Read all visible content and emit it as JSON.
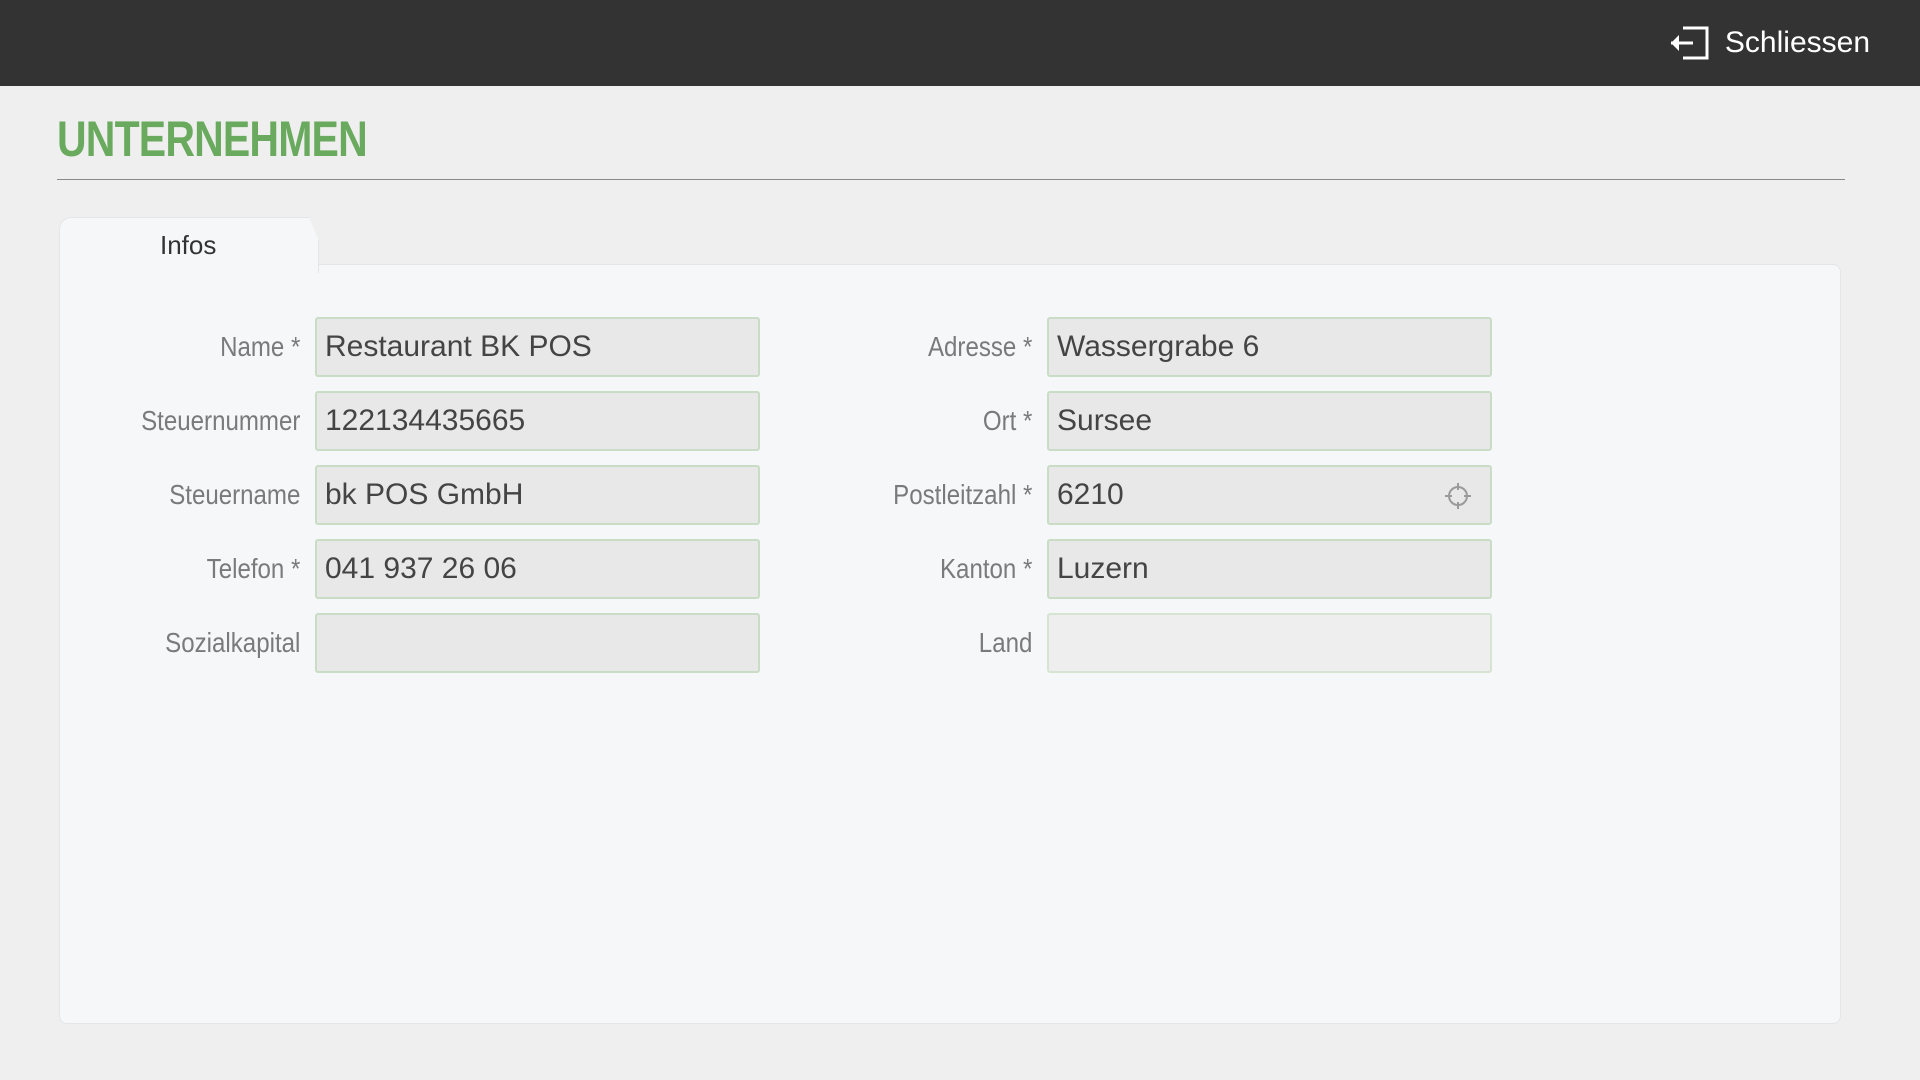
{
  "header": {
    "close_label": "Schliessen",
    "close_icon": "exit-icon"
  },
  "page": {
    "title": "UNTERNEHMEN",
    "title_color": "#6aaa5e"
  },
  "tabs": [
    {
      "label": "Infos",
      "active": true
    }
  ],
  "form": {
    "left": [
      {
        "label": "Name *",
        "value": "Restaurant BK POS"
      },
      {
        "label": "Steuernummer",
        "value": "122134435665"
      },
      {
        "label": "Steuername",
        "value": "bk POS GmbH"
      },
      {
        "label": "Telefon *",
        "value": "041 937 26 06"
      },
      {
        "label": "Sozialkapital",
        "value": ""
      }
    ],
    "right": [
      {
        "label": "Adresse *",
        "value": "Wassergrabe 6"
      },
      {
        "label": "Ort *",
        "value": "Sursee"
      },
      {
        "label": "Postleitzahl *",
        "value": "6210",
        "icon": "locate-icon"
      },
      {
        "label": "Kanton *",
        "value": "Luzern"
      },
      {
        "label": "Land",
        "value": ""
      }
    ]
  }
}
